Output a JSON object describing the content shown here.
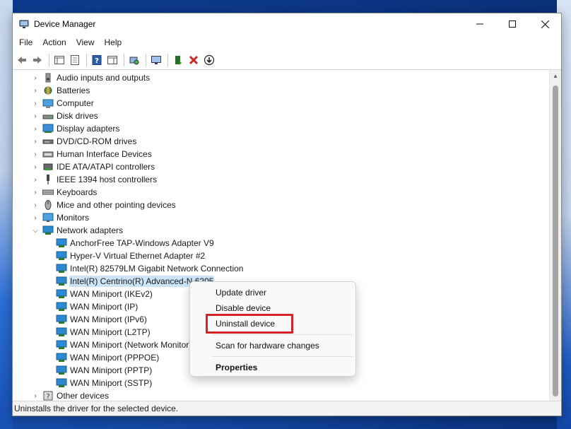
{
  "window": {
    "title": "Device Manager",
    "controls": [
      "minimize-icon",
      "maximize-icon",
      "close-icon"
    ]
  },
  "menu": [
    "File",
    "Action",
    "View",
    "Help"
  ],
  "toolbar": {
    "icons": [
      "back-arrow-icon",
      "forward-arrow-icon",
      "properties-pane-icon",
      "details-icon",
      "help-icon",
      "action-pane-icon",
      "scan-hardware-icon",
      "computer-monitor-icon",
      "enable-device-icon",
      "uninstall-x-icon",
      "update-driver-icon"
    ]
  },
  "tree": [
    {
      "label": "Audio inputs and outputs",
      "icon": "speaker-icon",
      "expanded": false
    },
    {
      "label": "Batteries",
      "icon": "battery-icon",
      "expanded": false
    },
    {
      "label": "Computer",
      "icon": "computer-icon",
      "expanded": false
    },
    {
      "label": "Disk drives",
      "icon": "disk-drive-icon",
      "expanded": false
    },
    {
      "label": "Display adapters",
      "icon": "display-adapter-icon",
      "expanded": false
    },
    {
      "label": "DVD/CD-ROM drives",
      "icon": "dvd-drive-icon",
      "expanded": false
    },
    {
      "label": "Human Interface Devices",
      "icon": "hid-icon",
      "expanded": false
    },
    {
      "label": "IDE ATA/ATAPI controllers",
      "icon": "ide-controller-icon",
      "expanded": false
    },
    {
      "label": "IEEE 1394 host controllers",
      "icon": "firewire-icon",
      "expanded": false
    },
    {
      "label": "Keyboards",
      "icon": "keyboard-icon",
      "expanded": false
    },
    {
      "label": "Mice and other pointing devices",
      "icon": "mouse-icon",
      "expanded": false
    },
    {
      "label": "Monitors",
      "icon": "monitor-icon",
      "expanded": false
    },
    {
      "label": "Network adapters",
      "icon": "network-adapter-icon",
      "expanded": true,
      "children": [
        {
          "label": "AnchorFree TAP-Windows Adapter V9"
        },
        {
          "label": "Hyper-V Virtual Ethernet Adapter #2"
        },
        {
          "label": "Intel(R) 82579LM Gigabit Network Connection"
        },
        {
          "label": "Intel(R) Centrino(R) Advanced-N 6205",
          "selected": true
        },
        {
          "label": "WAN Miniport (IKEv2)"
        },
        {
          "label": "WAN Miniport (IP)"
        },
        {
          "label": "WAN Miniport (IPv6)"
        },
        {
          "label": "WAN Miniport (L2TP)"
        },
        {
          "label": "WAN Miniport (Network Monitor)"
        },
        {
          "label": "WAN Miniport (PPPOE)"
        },
        {
          "label": "WAN Miniport (PPTP)"
        },
        {
          "label": "WAN Miniport (SSTP)"
        }
      ]
    },
    {
      "label": "Other devices",
      "icon": "other-devices-icon",
      "expanded": false
    }
  ],
  "context_menu": {
    "items": [
      "Update driver",
      "Disable device",
      "Uninstall device",
      "Scan for hardware changes",
      "Properties"
    ],
    "highlighted": "Uninstall device",
    "highlight_color": "#d42424"
  },
  "status": "Uninstalls the driver for the selected device.",
  "colors": {
    "selection": "#cce4f7",
    "network_icon": "#2a8ad4"
  }
}
